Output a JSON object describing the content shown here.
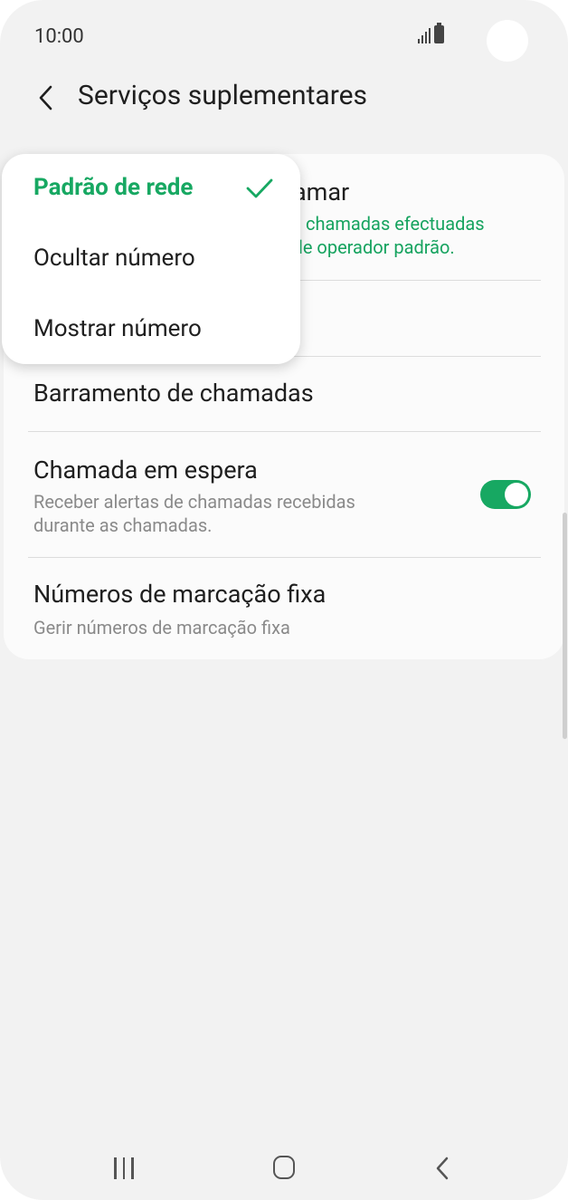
{
  "status_bar": {
    "time": "10:00"
  },
  "header": {
    "title": "Serviços suplementares",
    "back_icon": "chevron-left-icon"
  },
  "settings": {
    "caller_id": {
      "title_visible_fragment": "amar",
      "subtitle_line1": "chamadas efectuadas",
      "subtitle_line2": "le operador padrão."
    },
    "call_barring": {
      "title": "Barramento de chamadas"
    },
    "call_waiting": {
      "title": "Chamada em espera",
      "subtitle_line1": "Receber alertas de chamadas recebidas",
      "subtitle_line2": "durante as chamadas.",
      "enabled": true
    },
    "fixed_dialing": {
      "title": "Números de marcação fixa",
      "subtitle": "Gerir números de marcação fixa"
    }
  },
  "popup_menu": {
    "options": [
      {
        "label": "Padrão de rede",
        "selected": true
      },
      {
        "label": "Ocultar número",
        "selected": false
      },
      {
        "label": "Mostrar número",
        "selected": false
      }
    ]
  },
  "colors": {
    "accent": "#17a862",
    "background": "#f2f2f2",
    "card": "#fbfbfb"
  }
}
